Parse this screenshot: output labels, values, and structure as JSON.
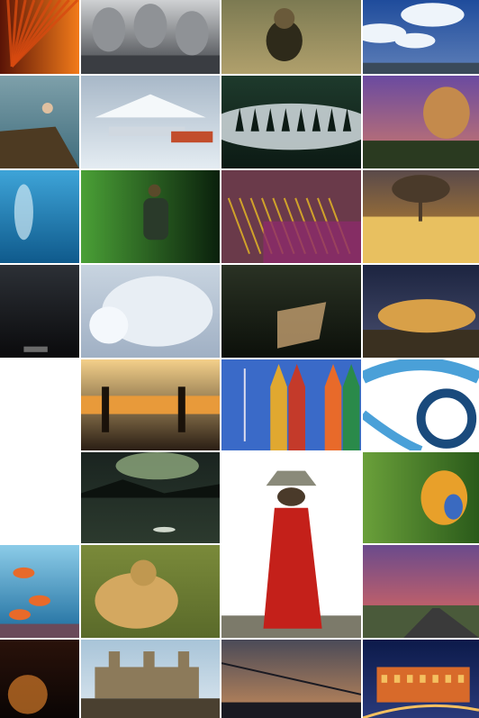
{
  "gallery": {
    "tiles": [
      {
        "id": "red-palm-leaf-tile",
        "scene": "leaf",
        "colors": [
          "#d84a10",
          "#f27b1a",
          "#5a1406"
        ]
      },
      {
        "id": "stone-carvers-tile",
        "scene": "workshop",
        "colors": [
          "#8f9296",
          "#cfd1d3",
          "#3a3d42"
        ]
      },
      {
        "id": "cheetah-cub-tile",
        "scene": "cub",
        "colors": [
          "#7c7a52",
          "#b0a06c",
          "#2e2a1a"
        ]
      },
      {
        "id": "blue-sky-clouds-tile",
        "scene": "sky",
        "colors": [
          "#1f4c9c",
          "#eef4fa",
          "#5e7fb8"
        ]
      },
      {
        "id": "cliff-diver-tile",
        "scene": "cliff",
        "colors": [
          "#3f6c7c",
          "#7ea0aa",
          "#4d3a22"
        ]
      },
      {
        "id": "antarctic-plane-tile",
        "scene": "plane",
        "colors": [
          "#a8b8c8",
          "#e4ecf2",
          "#c24d2c"
        ]
      },
      {
        "id": "misty-forest-tile",
        "scene": "mist",
        "colors": [
          "#1e3a2c",
          "#d4dde0",
          "#0c1a14"
        ]
      },
      {
        "id": "lion-sunset-tile",
        "scene": "lion",
        "colors": [
          "#6a4aa0",
          "#c48a4c",
          "#2a3a20"
        ]
      },
      {
        "id": "underwater-diver-tile",
        "scene": "diver",
        "colors": [
          "#0f5a8c",
          "#3ea4d8",
          "#cfe8f4"
        ]
      },
      {
        "id": "jungle-trekker-tile",
        "scene": "jungle",
        "colors": [
          "#1e5c22",
          "#4aa036",
          "#0a200c"
        ]
      },
      {
        "id": "textile-loom-tile",
        "scene": "loom",
        "colors": [
          "#6a3a4a",
          "#d0a22a",
          "#8c2a6a"
        ]
      },
      {
        "id": "savanna-tree-tile",
        "scene": "tree",
        "colors": [
          "#c88a2a",
          "#e8c060",
          "#4a3a2a"
        ]
      },
      {
        "id": "dark-room-tile",
        "scene": "dark",
        "colors": [
          "#1a1c20",
          "#2c3036",
          "#0a0a0c"
        ]
      },
      {
        "id": "polar-bear-tile",
        "scene": "bear",
        "colors": [
          "#e8eef4",
          "#c8d4e0",
          "#a0b0c4"
        ]
      },
      {
        "id": "shipwreck-tile",
        "scene": "wreck",
        "colors": [
          "#2a3224",
          "#c4a070",
          "#0c100a"
        ]
      },
      {
        "id": "cheetah-rock-tile",
        "scene": "cheetahrock",
        "colors": [
          "#1c2440",
          "#d8a048",
          "#3a3020"
        ]
      },
      {
        "id": "fishermen-sunset-tile",
        "scene": "fishermen",
        "colors": [
          "#2a1e14",
          "#e89a3a",
          "#f4d08a"
        ]
      },
      {
        "id": "beach-huts-tile",
        "scene": "huts",
        "colors": [
          "#3a6ac8",
          "#e0a830",
          "#c43a2a"
        ]
      },
      {
        "id": "film-reel-tile",
        "scene": "film",
        "colors": [
          "#4aa0d8",
          "#ffffff",
          "#1a4a7c"
        ]
      },
      {
        "id": "lake-canoe-tile",
        "scene": "lake",
        "colors": [
          "#1a2420",
          "#a0bc8c",
          "#2c3a2e"
        ]
      },
      {
        "id": "red-robe-tile",
        "scene": "robe",
        "colors": [
          "#c4201a",
          "#ffffff",
          "#7c7a6a"
        ]
      },
      {
        "id": "parrot-tile",
        "scene": "parrot",
        "colors": [
          "#2a5a1a",
          "#e8a02a",
          "#3a6ac0"
        ]
      },
      {
        "id": "coral-reef-tile",
        "scene": "reef",
        "colors": [
          "#1a6a9c",
          "#e86a2a",
          "#8ccce8"
        ]
      },
      {
        "id": "cheetahs-grass-tile",
        "scene": "cheetahs",
        "colors": [
          "#5a6a2a",
          "#d4a860",
          "#2a2a14"
        ]
      },
      {
        "id": "desert-road-tile",
        "scene": "road",
        "colors": [
          "#6a4a8c",
          "#e86a5a",
          "#3a3a3a"
        ]
      },
      {
        "id": "candle-dark-tile",
        "scene": "candle",
        "colors": [
          "#2a120a",
          "#d47a2a",
          "#0a0504"
        ]
      },
      {
        "id": "mud-mosque-tile",
        "scene": "mosque",
        "colors": [
          "#a8c4d8",
          "#8c7a5a",
          "#4a4030"
        ]
      },
      {
        "id": "high-wire-tile",
        "scene": "wire",
        "colors": [
          "#4a4a58",
          "#c48a5a",
          "#1a1a22"
        ]
      },
      {
        "id": "colosseum-night-tile",
        "scene": "colosseum",
        "colors": [
          "#0c1a4a",
          "#d86a2a",
          "#f4c060"
        ]
      }
    ]
  }
}
